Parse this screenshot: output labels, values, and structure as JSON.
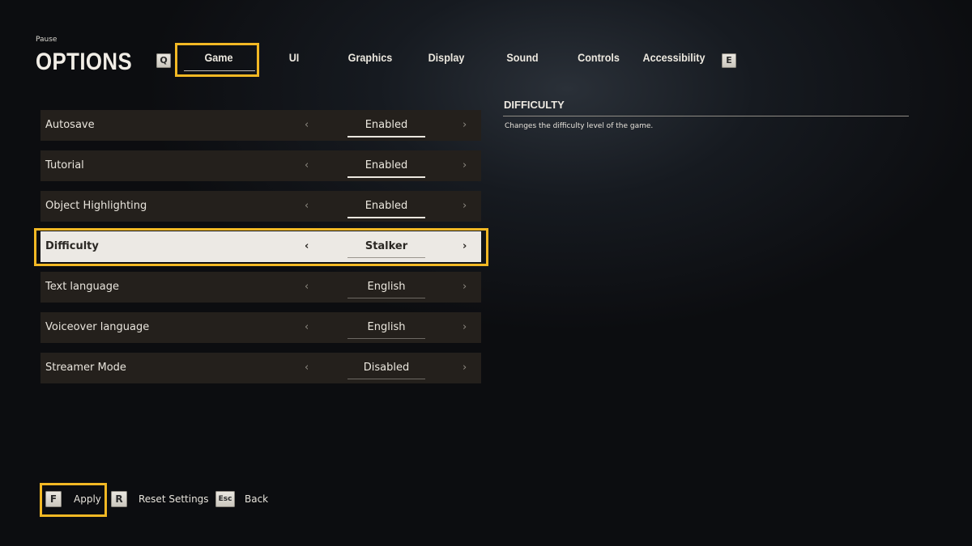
{
  "header": {
    "breadcrumb": "Pause",
    "title": "OPTIONS",
    "prev_key": "Q",
    "next_key": "E"
  },
  "tabs": [
    {
      "label": "Game",
      "active": true
    },
    {
      "label": "UI"
    },
    {
      "label": "Graphics"
    },
    {
      "label": "Display"
    },
    {
      "label": "Sound"
    },
    {
      "label": "Controls"
    },
    {
      "label": "Accessibility"
    }
  ],
  "settings": [
    {
      "label": "Autosave",
      "value": "Enabled"
    },
    {
      "label": "Tutorial",
      "value": "Enabled"
    },
    {
      "label": "Object Highlighting",
      "value": "Enabled"
    },
    {
      "label": "Difficulty",
      "value": "Stalker",
      "selected": true
    },
    {
      "label": "Text language",
      "value": "English"
    },
    {
      "label": "Voiceover language",
      "value": "English"
    },
    {
      "label": "Streamer Mode",
      "value": "Disabled"
    }
  ],
  "arrows": {
    "left": "‹",
    "right": "›"
  },
  "description": {
    "title": "DIFFICULTY",
    "text": "Changes the difficulty level of the game."
  },
  "footer": {
    "apply_key": "F",
    "apply_label": "Apply",
    "reset_key": "R",
    "reset_label": "Reset Settings",
    "back_key": "Esc",
    "back_label": "Back"
  },
  "colors": {
    "accent": "#f2b824",
    "row_bg": "#24201c",
    "selected_bg": "#ece9e4"
  }
}
